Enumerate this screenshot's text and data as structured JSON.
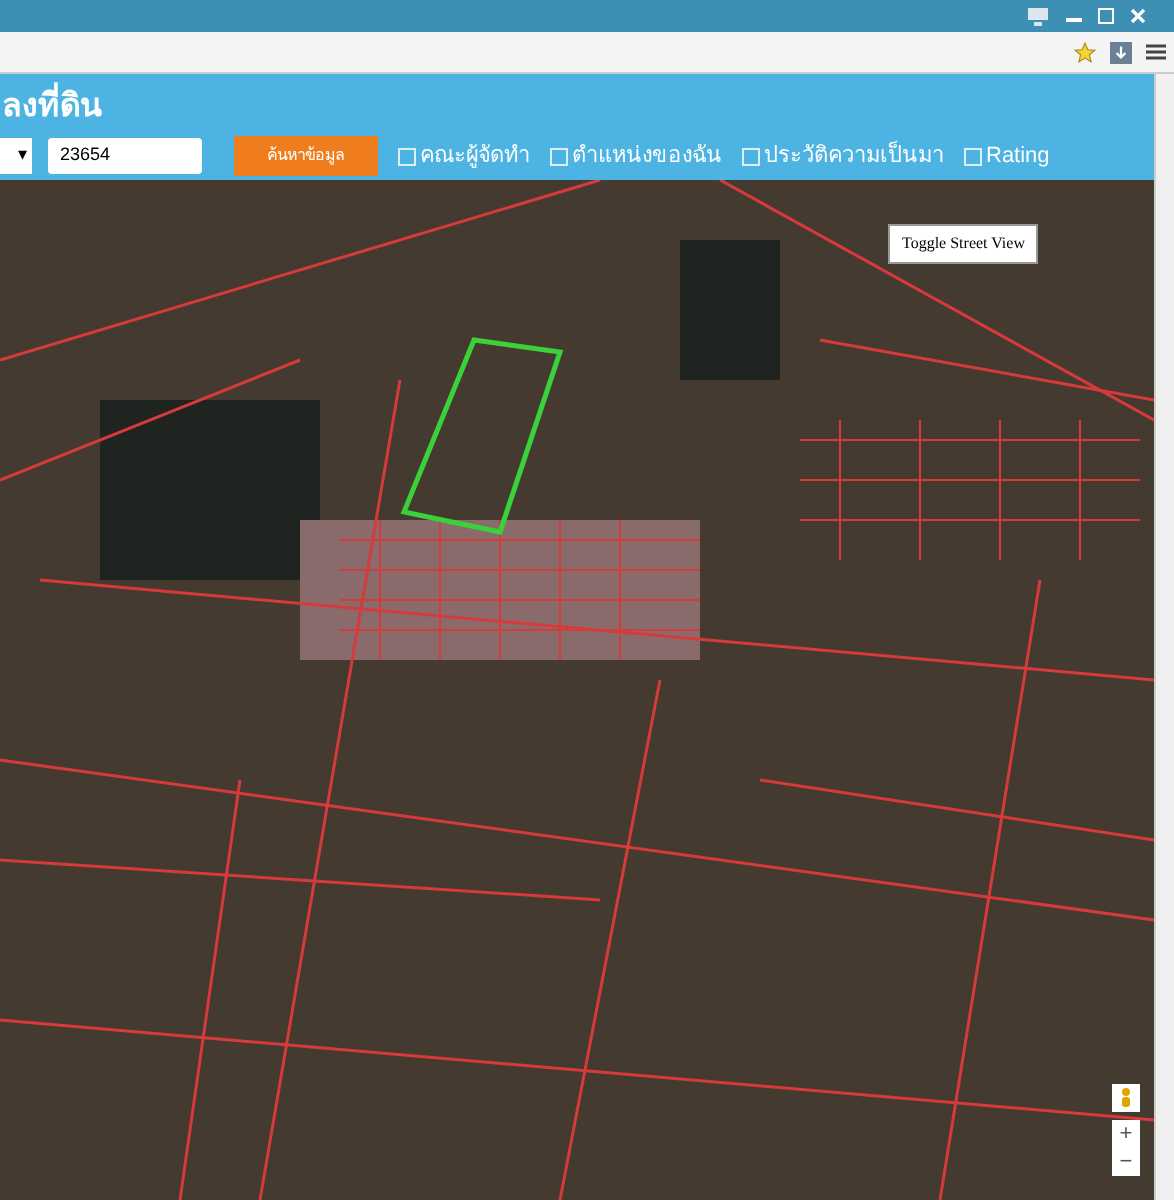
{
  "header": {
    "title": "ลงที่ดิน"
  },
  "search": {
    "dropdown_arrow": "▾",
    "value": "23654",
    "button": "ค้นหาข้อมูล"
  },
  "options": [
    {
      "label": "คณะผู้จัดทำ",
      "checked": false
    },
    {
      "label": "ตำแหน่งของฉัน",
      "checked": false
    },
    {
      "label": "ประวัติความเป็นมา",
      "checked": false
    },
    {
      "label": "Rating",
      "checked": false
    }
  ],
  "map": {
    "street_view_button": "Toggle Street View",
    "zoom_in": "+",
    "zoom_out": "−"
  }
}
